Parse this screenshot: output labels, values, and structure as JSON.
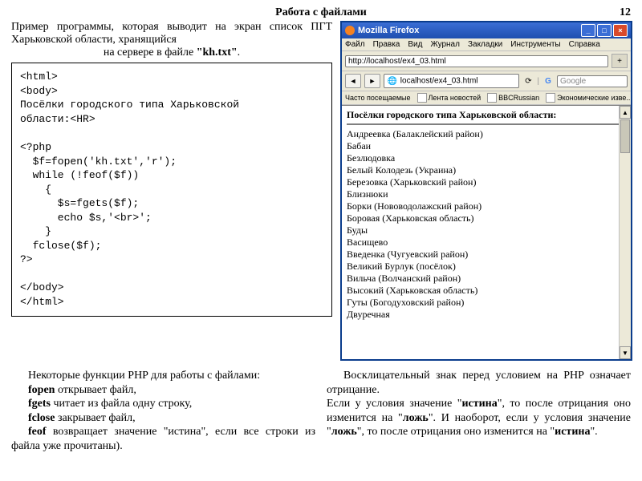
{
  "page": {
    "title": "Работа с файлами",
    "number": "12"
  },
  "intro": {
    "t1": "Пример программы, которая выводит на экран список ПГТ Харьковской области, хранящийся",
    "t2_prefix": "на сервере в файле ",
    "t2_bold": "\"kh.txt\"",
    "t2_suffix": "."
  },
  "code": "<html>\n<body>\nПосёлки городского типа Харьковской\nобласти:<HR>\n\n<?php\n  $f=fopen('kh.txt','r');\n  while (!feof($f))\n    {\n      $s=fgets($f);\n      echo $s,'<br>';\n    }\n  fclose($f);\n?>\n\n</body>\n</html>",
  "browser": {
    "title": "Mozilla Firefox",
    "menu": [
      "Файл",
      "Правка",
      "Вид",
      "Журнал",
      "Закладки",
      "Инструменты",
      "Справка"
    ],
    "url_tab": "http://localhost/ex4_03.html",
    "url_bar": "localhost/ex4_03.html",
    "search_placeholder": "Google",
    "bookmarks_label": "Часто посещаемые",
    "bookmarks": [
      "Лента новостей",
      "BBCRussian",
      "Экономические изве..."
    ],
    "content_heading": "Посёлки городского типа Харьковской области:",
    "items": [
      "Андреевка (Балаклейский район)",
      "Бабаи",
      "Безлюдовка",
      "Белый Колодезь (Украина)",
      "Березовка (Харьковский район)",
      "Близнюки",
      "Борки (Нововодолажский район)",
      "Боровая (Харьковская область)",
      "Буды",
      "Васищево",
      "Введенка (Чугуевский район)",
      "Великий Бурлук (посёлок)",
      "Вильча (Волчанский район)",
      "Высокий (Харьковская область)",
      "Гуты (Богодуховский район)",
      "Двуречная"
    ]
  },
  "bottom_left": {
    "p1": "Некоторые функции PHP для работы с файлами:",
    "l1_b": "fopen",
    "l1": " открывает файл,",
    "l2_b": "fgets",
    "l2": " читает из файла одну строку,",
    "l3_b": "fclose",
    "l3": " закрывает файл,",
    "l4_b": "feof",
    "l4": " возвращает значение \"истина\", если все строки из файла уже прочитаны)."
  },
  "bottom_right": {
    "p1": "Восклицательный знак перед условием на PHP означает отрицание.",
    "p2a": "Если у условия значение \"",
    "p2b": "истина",
    "p2c": "\", то после отрицания оно изменится на \"",
    "p2d": "ложь",
    "p2e": "\". И наоборот, если у условия значение \"",
    "p2f": "ложь",
    "p2g": "\", то после отрицания оно изменится на \"",
    "p2h": "истина",
    "p2i": "\"."
  }
}
